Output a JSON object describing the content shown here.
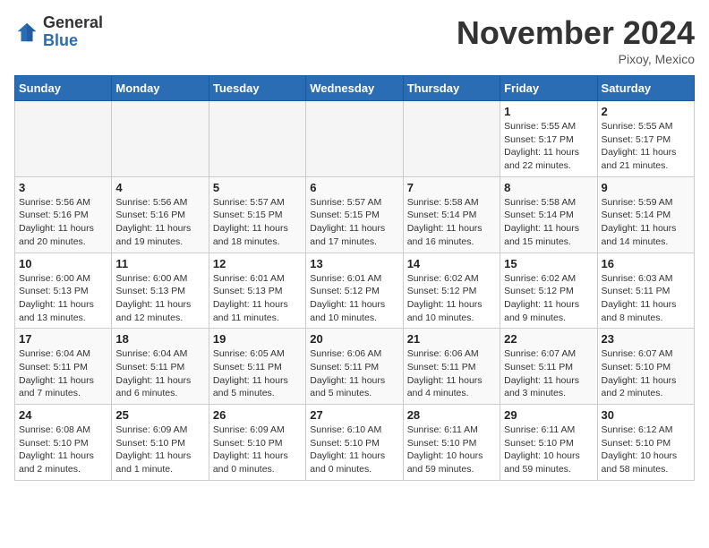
{
  "header": {
    "logo": {
      "line1": "General",
      "line2": "Blue"
    },
    "month": "November 2024",
    "location": "Pixoy, Mexico"
  },
  "weekdays": [
    "Sunday",
    "Monday",
    "Tuesday",
    "Wednesday",
    "Thursday",
    "Friday",
    "Saturday"
  ],
  "weeks": [
    [
      {
        "day": "",
        "info": ""
      },
      {
        "day": "",
        "info": ""
      },
      {
        "day": "",
        "info": ""
      },
      {
        "day": "",
        "info": ""
      },
      {
        "day": "",
        "info": ""
      },
      {
        "day": "1",
        "info": "Sunrise: 5:55 AM\nSunset: 5:17 PM\nDaylight: 11 hours\nand 22 minutes."
      },
      {
        "day": "2",
        "info": "Sunrise: 5:55 AM\nSunset: 5:17 PM\nDaylight: 11 hours\nand 21 minutes."
      }
    ],
    [
      {
        "day": "3",
        "info": "Sunrise: 5:56 AM\nSunset: 5:16 PM\nDaylight: 11 hours\nand 20 minutes."
      },
      {
        "day": "4",
        "info": "Sunrise: 5:56 AM\nSunset: 5:16 PM\nDaylight: 11 hours\nand 19 minutes."
      },
      {
        "day": "5",
        "info": "Sunrise: 5:57 AM\nSunset: 5:15 PM\nDaylight: 11 hours\nand 18 minutes."
      },
      {
        "day": "6",
        "info": "Sunrise: 5:57 AM\nSunset: 5:15 PM\nDaylight: 11 hours\nand 17 minutes."
      },
      {
        "day": "7",
        "info": "Sunrise: 5:58 AM\nSunset: 5:14 PM\nDaylight: 11 hours\nand 16 minutes."
      },
      {
        "day": "8",
        "info": "Sunrise: 5:58 AM\nSunset: 5:14 PM\nDaylight: 11 hours\nand 15 minutes."
      },
      {
        "day": "9",
        "info": "Sunrise: 5:59 AM\nSunset: 5:14 PM\nDaylight: 11 hours\nand 14 minutes."
      }
    ],
    [
      {
        "day": "10",
        "info": "Sunrise: 6:00 AM\nSunset: 5:13 PM\nDaylight: 11 hours\nand 13 minutes."
      },
      {
        "day": "11",
        "info": "Sunrise: 6:00 AM\nSunset: 5:13 PM\nDaylight: 11 hours\nand 12 minutes."
      },
      {
        "day": "12",
        "info": "Sunrise: 6:01 AM\nSunset: 5:13 PM\nDaylight: 11 hours\nand 11 minutes."
      },
      {
        "day": "13",
        "info": "Sunrise: 6:01 AM\nSunset: 5:12 PM\nDaylight: 11 hours\nand 10 minutes."
      },
      {
        "day": "14",
        "info": "Sunrise: 6:02 AM\nSunset: 5:12 PM\nDaylight: 11 hours\nand 10 minutes."
      },
      {
        "day": "15",
        "info": "Sunrise: 6:02 AM\nSunset: 5:12 PM\nDaylight: 11 hours\nand 9 minutes."
      },
      {
        "day": "16",
        "info": "Sunrise: 6:03 AM\nSunset: 5:11 PM\nDaylight: 11 hours\nand 8 minutes."
      }
    ],
    [
      {
        "day": "17",
        "info": "Sunrise: 6:04 AM\nSunset: 5:11 PM\nDaylight: 11 hours\nand 7 minutes."
      },
      {
        "day": "18",
        "info": "Sunrise: 6:04 AM\nSunset: 5:11 PM\nDaylight: 11 hours\nand 6 minutes."
      },
      {
        "day": "19",
        "info": "Sunrise: 6:05 AM\nSunset: 5:11 PM\nDaylight: 11 hours\nand 5 minutes."
      },
      {
        "day": "20",
        "info": "Sunrise: 6:06 AM\nSunset: 5:11 PM\nDaylight: 11 hours\nand 5 minutes."
      },
      {
        "day": "21",
        "info": "Sunrise: 6:06 AM\nSunset: 5:11 PM\nDaylight: 11 hours\nand 4 minutes."
      },
      {
        "day": "22",
        "info": "Sunrise: 6:07 AM\nSunset: 5:11 PM\nDaylight: 11 hours\nand 3 minutes."
      },
      {
        "day": "23",
        "info": "Sunrise: 6:07 AM\nSunset: 5:10 PM\nDaylight: 11 hours\nand 2 minutes."
      }
    ],
    [
      {
        "day": "24",
        "info": "Sunrise: 6:08 AM\nSunset: 5:10 PM\nDaylight: 11 hours\nand 2 minutes."
      },
      {
        "day": "25",
        "info": "Sunrise: 6:09 AM\nSunset: 5:10 PM\nDaylight: 11 hours\nand 1 minute."
      },
      {
        "day": "26",
        "info": "Sunrise: 6:09 AM\nSunset: 5:10 PM\nDaylight: 11 hours\nand 0 minutes."
      },
      {
        "day": "27",
        "info": "Sunrise: 6:10 AM\nSunset: 5:10 PM\nDaylight: 11 hours\nand 0 minutes."
      },
      {
        "day": "28",
        "info": "Sunrise: 6:11 AM\nSunset: 5:10 PM\nDaylight: 10 hours\nand 59 minutes."
      },
      {
        "day": "29",
        "info": "Sunrise: 6:11 AM\nSunset: 5:10 PM\nDaylight: 10 hours\nand 59 minutes."
      },
      {
        "day": "30",
        "info": "Sunrise: 6:12 AM\nSunset: 5:10 PM\nDaylight: 10 hours\nand 58 minutes."
      }
    ]
  ]
}
